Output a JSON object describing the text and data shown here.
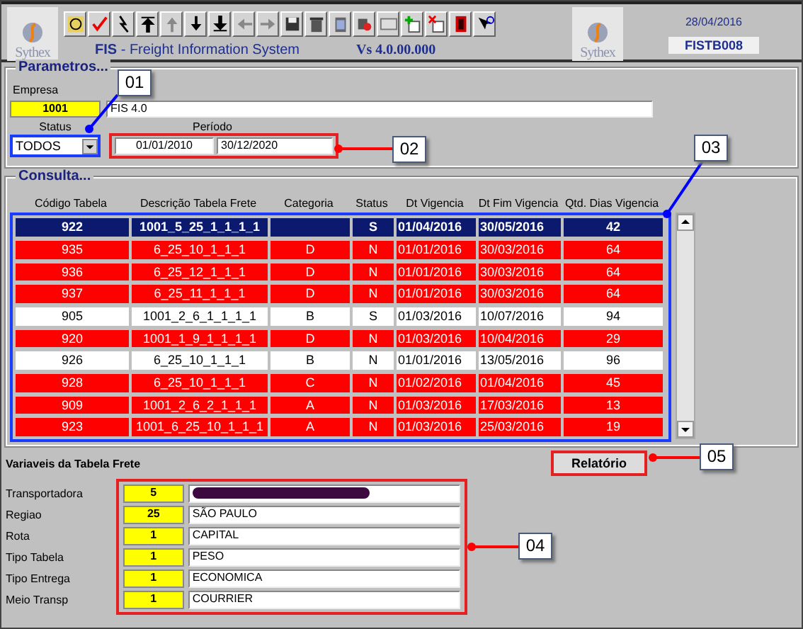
{
  "header": {
    "logo_text": "Sythex",
    "title_prefix": "FIS",
    "title": " - Freight Information System",
    "version": "Vs 4.0.00.000",
    "right_logo_text": "Sythex",
    "date": "28/04/2016",
    "screen_code": "FISTB008"
  },
  "parametros": {
    "legend": "Parametros...",
    "empresa_label": "Empresa",
    "empresa_code": "1001",
    "empresa_name": "FIS 4.0",
    "status_label": "Status",
    "status_value": "TODOS",
    "periodo_label": "Período",
    "periodo_from": "01/01/2010",
    "periodo_to": "30/12/2020"
  },
  "consulta": {
    "legend": "Consulta...",
    "columns": [
      "Código Tabela",
      "Descrição Tabela Frete",
      "Categoria",
      "Status",
      "Dt Vigencia",
      "Dt Fim Vigencia",
      "Qtd. Dias Vigencia"
    ],
    "rows": [
      {
        "cells": [
          "922",
          "1001_5_25_1_1_1_1",
          "",
          "S",
          "01/04/2016",
          "30/05/2016",
          "42"
        ],
        "selected": true,
        "expired": false
      },
      {
        "cells": [
          "935",
          "6_25_10_1_1_1",
          "D",
          "N",
          "01/01/2016",
          "30/03/2016",
          "64"
        ],
        "selected": false,
        "expired": true
      },
      {
        "cells": [
          "936",
          "6_25_12_1_1_1",
          "D",
          "N",
          "01/01/2016",
          "30/03/2016",
          "64"
        ],
        "selected": false,
        "expired": true
      },
      {
        "cells": [
          "937",
          "6_25_11_1_1_1",
          "D",
          "N",
          "01/01/2016",
          "30/03/2016",
          "64"
        ],
        "selected": false,
        "expired": true
      },
      {
        "cells": [
          "905",
          "1001_2_6_1_1_1_1",
          "B",
          "S",
          "01/03/2016",
          "10/07/2016",
          "94"
        ],
        "selected": false,
        "expired": false
      },
      {
        "cells": [
          "920",
          "1001_1_9_1_1_1_1",
          "D",
          "N",
          "01/03/2016",
          "10/04/2016",
          "29"
        ],
        "selected": false,
        "expired": true
      },
      {
        "cells": [
          "926",
          "6_25_10_1_1_1",
          "B",
          "N",
          "01/01/2016",
          "13/05/2016",
          "96"
        ],
        "selected": false,
        "expired": false
      },
      {
        "cells": [
          "928",
          "6_25_10_1_1_1",
          "C",
          "N",
          "01/02/2016",
          "01/04/2016",
          "45"
        ],
        "selected": false,
        "expired": true
      },
      {
        "cells": [
          "909",
          "1001_2_6_2_1_1_1",
          "A",
          "N",
          "01/03/2016",
          "17/03/2016",
          "13"
        ],
        "selected": false,
        "expired": true
      },
      {
        "cells": [
          "923",
          "1001_6_25_10_1_1_1",
          "A",
          "N",
          "01/03/2016",
          "25/03/2016",
          "19"
        ],
        "selected": false,
        "expired": true
      }
    ]
  },
  "variaveis": {
    "title": "Variaveis da Tabela Frete",
    "report_button": "Relatório",
    "rows": [
      {
        "label": "Transportadora",
        "code": "5",
        "value": "",
        "redacted": true
      },
      {
        "label": "Regiao",
        "code": "25",
        "value": "SÃO PAULO",
        "redacted": false
      },
      {
        "label": "Rota",
        "code": "1",
        "value": "CAPITAL",
        "redacted": false
      },
      {
        "label": "Tipo Tabela",
        "code": "1",
        "value": "PESO",
        "redacted": false
      },
      {
        "label": "Tipo Entrega",
        "code": "1",
        "value": "ECONOMICA",
        "redacted": false
      },
      {
        "label": "Meio Transp",
        "code": "1",
        "value": "COURRIER",
        "redacted": false
      }
    ]
  },
  "callouts": [
    {
      "label": "01",
      "color": "#0000ff"
    },
    {
      "label": "02",
      "color": "#ff0000"
    },
    {
      "label": "03",
      "color": "#0000ff"
    },
    {
      "label": "04",
      "color": "#ff0000"
    },
    {
      "label": "05",
      "color": "#ff0000"
    }
  ]
}
